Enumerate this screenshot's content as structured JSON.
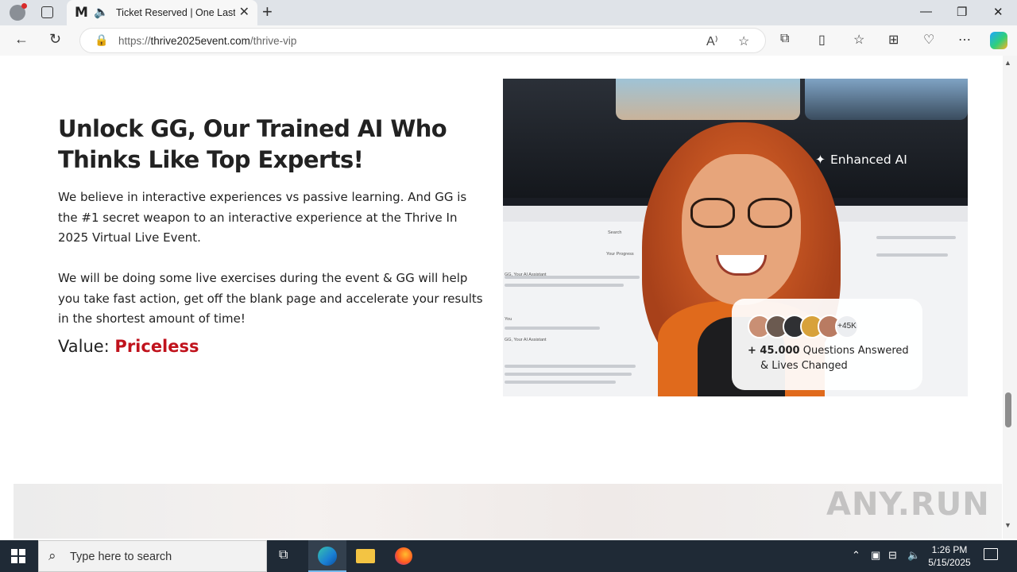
{
  "browser": {
    "tab_title": "Ticket Reserved | One Last St",
    "url_prefix": "https://",
    "url_domain": "thrive2025event.com",
    "url_path": "/thrive-vip"
  },
  "content": {
    "headline": "Unlock GG, Our Trained AI Who Thinks Like Top Experts!",
    "paragraph1": "We believe in interactive experiences vs passive learning. And GG is the #1 secret weapon to an interactive experience at the Thrive In 2025 Virtual Live Event.",
    "paragraph2": "We will be doing some live exercises during the event & GG will help you take fast action, get off the blank page and accelerate your results in the shortest amount of time!",
    "value_label": "Value: ",
    "value_text": "Priceless",
    "value_color": "#c0121c"
  },
  "hero_image": {
    "badge_text": "Enhanced AI",
    "avatar_count": "+45K",
    "stat_bold": "+ 45.000",
    "stat_line1": "Questions Answered",
    "stat_line2": "& Lives Changed",
    "screen_labels": [
      "GG, Your AI Assistant",
      "You",
      "GG, Your AI Assistant",
      "Your Progress",
      "Search"
    ]
  },
  "watermark": "ANY.RUN",
  "taskbar": {
    "search_placeholder": "Type here to search",
    "time": "1:26 PM",
    "date": "5/15/2025"
  }
}
